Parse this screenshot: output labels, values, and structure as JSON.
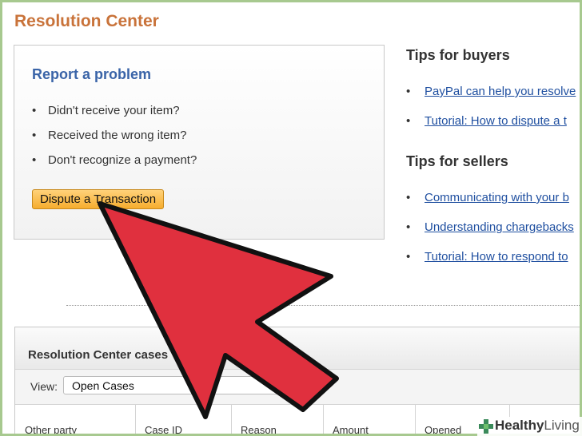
{
  "page": {
    "title": "Resolution Center"
  },
  "report_problem": {
    "title": "Report a problem",
    "items": [
      "Didn't receive your item?",
      "Received the wrong item?",
      "Don't recognize a payment?"
    ],
    "button_label": "Dispute a Transaction"
  },
  "tips_buyers": {
    "heading": "Tips for buyers",
    "links": [
      "PayPal can help you resolve",
      "Tutorial: How to dispute a t"
    ]
  },
  "tips_sellers": {
    "heading": "Tips for sellers",
    "links": [
      "Communicating with your b",
      "Understanding chargebacks",
      "Tutorial: How to respond to"
    ]
  },
  "cases": {
    "title": "Resolution Center cases",
    "view_label": "View:",
    "view_value": "Open Cases",
    "columns": [
      "Other party",
      "Case ID",
      "Reason",
      "Amount",
      "Opened"
    ]
  },
  "watermark": {
    "brand_bold": "Healthy",
    "brand_light": "Living"
  },
  "colors": {
    "title_orange": "#c9733a",
    "link_blue": "#1f4fa0",
    "arrow_red": "#e0303e",
    "button_orange": "#f6ad2e",
    "frame_green": "#a7c98f"
  }
}
